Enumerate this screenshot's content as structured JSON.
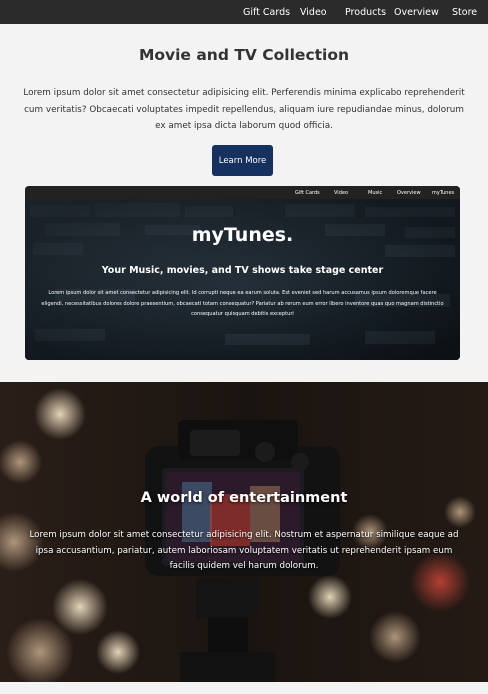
{
  "nav": {
    "items": [
      "Gift Cards",
      "Video",
      "Products",
      "Overview",
      "Store"
    ]
  },
  "hero": {
    "title": "Movie and TV Collection",
    "text": "Lorem ipsum dolor sit amet consectetur adipisicing elit. Perferendis minima explicabo reprehenderit cum veritatis? Obcaecati voluptates impedit repellendus, aliquam iure repudiandae minus, dolorum ex amet ipsa dicta laborum quod officia.",
    "button_label": "Learn More"
  },
  "preview": {
    "nav_items": [
      "Gift Cards",
      "Video",
      "Music",
      "Overview",
      "myTunes"
    ],
    "title": "myTunes.",
    "subtitle": "Your Music, movies, and TV shows take stage center",
    "body": "Lorem ipsum dolor sit amet consectetur adipisicing elit. Id corrupti neque ea earum soluta. Est eveniet sed harum accusamus ipsum doloremque facere eligendi, necessitatibus dolores dolore praesentium, obcaecati totam consequatur? Pariatur ab rerum eum error libero inventore quas quo magnam distinctio consequatur quisquam debitis excepturi"
  },
  "entertainment": {
    "title": "A world of entertainment",
    "text": "Lorem ipsum dolor sit amet consectetur adipisicing elit. Nostrum et aspernatur similique eaque ad ipsa accusantium, pariatur, autem laboriosam voluptatem veritatis ut reprehenderit ipsam eum facilis quidem vel harum dolorum."
  },
  "colors": {
    "nav_bg": "#2b2b2b",
    "hero_bg": "#f3f3f3",
    "button_bg": "#16315e",
    "text": "#333333"
  }
}
